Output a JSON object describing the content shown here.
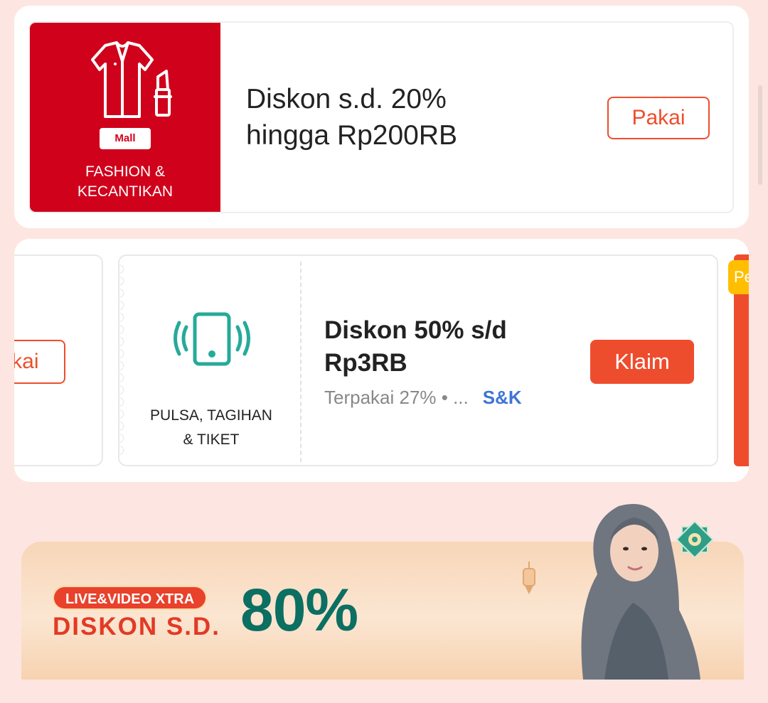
{
  "voucher_fashion": {
    "mall_badge": "Mall",
    "category_line1": "FASHION &",
    "category_line2": "KECANTIKAN",
    "title_line1": "Diskon s.d. 20%",
    "title_line2": "hingga Rp200RB",
    "button": "Pakai",
    "icon": "shirt-lipstick-icon"
  },
  "voucher_partial_left": {
    "button": "akai"
  },
  "voucher_pulsa": {
    "icon": "phone-vibrate-icon",
    "category_line1": "PULSA, TAGIHAN",
    "category_line2": "& TIKET",
    "title_line1": "Diskon 50% s/d",
    "title_line2": "Rp3RB",
    "usage": "Terpakai 27% • ...",
    "terms": "S&K",
    "button": "Klaim"
  },
  "voucher_partial_right": {
    "tag": "Pe"
  },
  "banner": {
    "badge": "LIVE&VIDEO XTRA",
    "headline": "DISKON S.D.",
    "percent": "80%"
  },
  "colors": {
    "brand_red": "#d0011b",
    "accent_orange": "#ee4d2d",
    "teal": "#26aa99",
    "link_blue": "#3d75d6",
    "page_bg": "#fde6e1"
  }
}
